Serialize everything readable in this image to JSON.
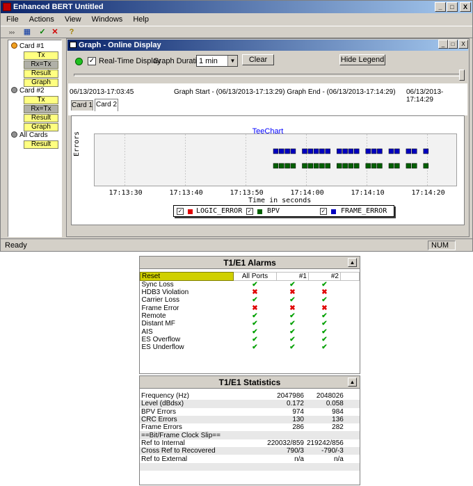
{
  "window": {
    "title": "Enhanced BERT Untitled",
    "menu": [
      "File",
      "Actions",
      "View",
      "Windows",
      "Help"
    ],
    "controls": [
      "_",
      "□",
      "X"
    ]
  },
  "toolbar": {
    "icons": [
      "connect-icon",
      "grid-icon",
      "check-icon",
      "cancel-icon",
      "help-icon"
    ],
    "glyphs": [
      "›››",
      "▦",
      "✓",
      "✕",
      "?"
    ]
  },
  "sidebar": {
    "card1": {
      "label": "Card #1",
      "color": "#f0a020",
      "buttons": [
        "Tx",
        "Rx=Tx",
        "Result",
        "Graph"
      ]
    },
    "card2": {
      "label": "Card #2",
      "color": "#808080",
      "buttons": [
        "Tx",
        "Rx=Tx",
        "Result",
        "Graph"
      ]
    },
    "allcards": {
      "label": "All Cards",
      "color": "#808080",
      "buttons": [
        "Result"
      ]
    }
  },
  "graph": {
    "title": "Graph - Online Display",
    "realtime_label": "Real-Time Display",
    "duration_label": "Graph Duration",
    "duration_value": "1 min",
    "clear_label": "Clear",
    "hide_legend_label": "Hide Legend",
    "left_time": "06/13/2013-17:03:45",
    "range_text": "Graph Start - (06/13/2013-17:13:29) Graph End - (06/13/2013-17:14:29)",
    "right_time": "06/13/2013-17:14:29",
    "tabs": [
      "Card 1",
      "Card 2"
    ],
    "active_tab": 1
  },
  "chart_data": {
    "type": "scatter",
    "title": "TeeChart",
    "xlabel": "Time in seconds",
    "ylabel": "Errors",
    "xticks": [
      "17:13:30",
      "17:13:40",
      "17:13:50",
      "17:14:00",
      "17:14:10",
      "17:14:20"
    ],
    "xlim": [
      27,
      57
    ],
    "series": [
      {
        "name": "LOGIC_ERROR",
        "color": "#e00000",
        "level": 0,
        "x": []
      },
      {
        "name": "BPV",
        "color": "#006000",
        "level": 1,
        "x": [
          29,
          30,
          31,
          32,
          34,
          35,
          36,
          37,
          38,
          40,
          41,
          42,
          43,
          45,
          46,
          47,
          49,
          50,
          52,
          53,
          55
        ]
      },
      {
        "name": "FRAME_ERROR",
        "color": "#0000c0",
        "level": 2,
        "x": [
          29,
          30,
          31,
          32,
          34,
          35,
          36,
          37,
          38,
          40,
          41,
          42,
          43,
          45,
          46,
          47,
          49,
          50,
          52,
          53,
          55
        ]
      }
    ]
  },
  "status": {
    "left": "Ready",
    "num": "NUM"
  },
  "alarms": {
    "title": "T1/E1 Alarms",
    "columns": [
      "Reset",
      "All Ports",
      "#1",
      "#2"
    ],
    "rows": [
      {
        "name": "Sync Loss",
        "v": [
          "ok",
          "ok",
          "ok"
        ]
      },
      {
        "name": "HDB3 Violation",
        "v": [
          "x",
          "x",
          "x"
        ]
      },
      {
        "name": "Carrier Loss",
        "v": [
          "ok",
          "ok",
          "ok"
        ]
      },
      {
        "name": "Frame Error",
        "v": [
          "x",
          "x",
          "x"
        ]
      },
      {
        "name": "Remote",
        "v": [
          "ok",
          "ok",
          "ok"
        ]
      },
      {
        "name": "Distant MF",
        "v": [
          "ok",
          "ok",
          "ok"
        ]
      },
      {
        "name": "AIS",
        "v": [
          "ok",
          "ok",
          "ok"
        ]
      },
      {
        "name": "ES Overflow",
        "v": [
          "ok",
          "ok",
          "ok"
        ]
      },
      {
        "name": "ES Underflow",
        "v": [
          "ok",
          "ok",
          "ok"
        ]
      }
    ]
  },
  "stats": {
    "title": "T1/E1 Statistics",
    "rows": [
      {
        "name": "Frequency (Hz)",
        "a": "2047986",
        "b": "2048026"
      },
      {
        "name": "Level (dBdsx)",
        "a": "0.172",
        "b": "0.058"
      },
      {
        "name": "BPV Errors",
        "a": "974",
        "b": "984"
      },
      {
        "name": "CRC Errors",
        "a": "130",
        "b": "136"
      },
      {
        "name": "Frame Errors",
        "a": "286",
        "b": "282"
      },
      {
        "name": "==Bit/Frame Clock Slip==",
        "a": "",
        "b": ""
      },
      {
        "name": "Ref to Internal",
        "a": "220032/859",
        "b": "219242/856"
      },
      {
        "name": "Cross Ref to Recovered",
        "a": "790/3",
        "b": "-790/-3"
      },
      {
        "name": "Ref to External",
        "a": "n/a",
        "b": "n/a"
      }
    ]
  }
}
